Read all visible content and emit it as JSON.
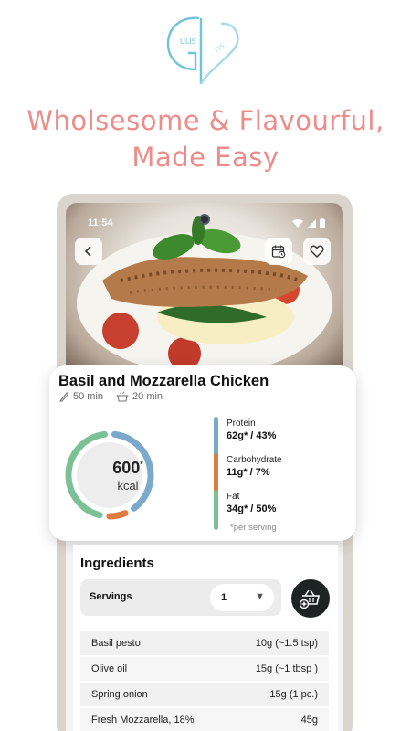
{
  "promo": {
    "headline_line1": "Wholsesome & Flavourful,",
    "headline_line2": "Made Easy",
    "logo_mark": "gulis"
  },
  "status_bar": {
    "time": "11:54",
    "icons": [
      "wifi-icon",
      "signal-icon",
      "battery-icon"
    ]
  },
  "recipe": {
    "title": "Basil and Mozzarella Chicken",
    "prep_time": "50 min",
    "cook_time": "20 min",
    "energy_value": "600",
    "energy_asterisk": "*",
    "energy_unit": "kcal",
    "macros": [
      {
        "name": "Protein",
        "value": "62g* / 43%",
        "share": 0.43,
        "color": "#7ba9cc"
      },
      {
        "name": "Carbohydrate",
        "value": "11g* / 7%",
        "share": 0.07,
        "color": "#e07b3c"
      },
      {
        "name": "Fat",
        "value": "34g* / 50%",
        "share": 0.5,
        "color": "#7cc095"
      }
    ],
    "per_serving_note": "*per serving"
  },
  "ingredients": {
    "title": "Ingredients",
    "servings_label": "Servings",
    "servings_value": "1",
    "items": [
      {
        "name": "Basil pesto",
        "amount": "10g (~1.5 tsp)"
      },
      {
        "name": "Olive oil",
        "amount": "15g (~1 tbsp )"
      },
      {
        "name": "Spring onion",
        "amount": "15g (1 pc.)"
      },
      {
        "name": "Fresh Mozzarella, 18%",
        "amount": "45g"
      }
    ]
  },
  "colors": {
    "brand_pink": "#ec8d8a",
    "logo_blue": "#73c4d8",
    "protein": "#7ba9cc",
    "carbohydrate": "#e07b3c",
    "fat": "#7cc095",
    "basket_button": "#1d2322"
  }
}
